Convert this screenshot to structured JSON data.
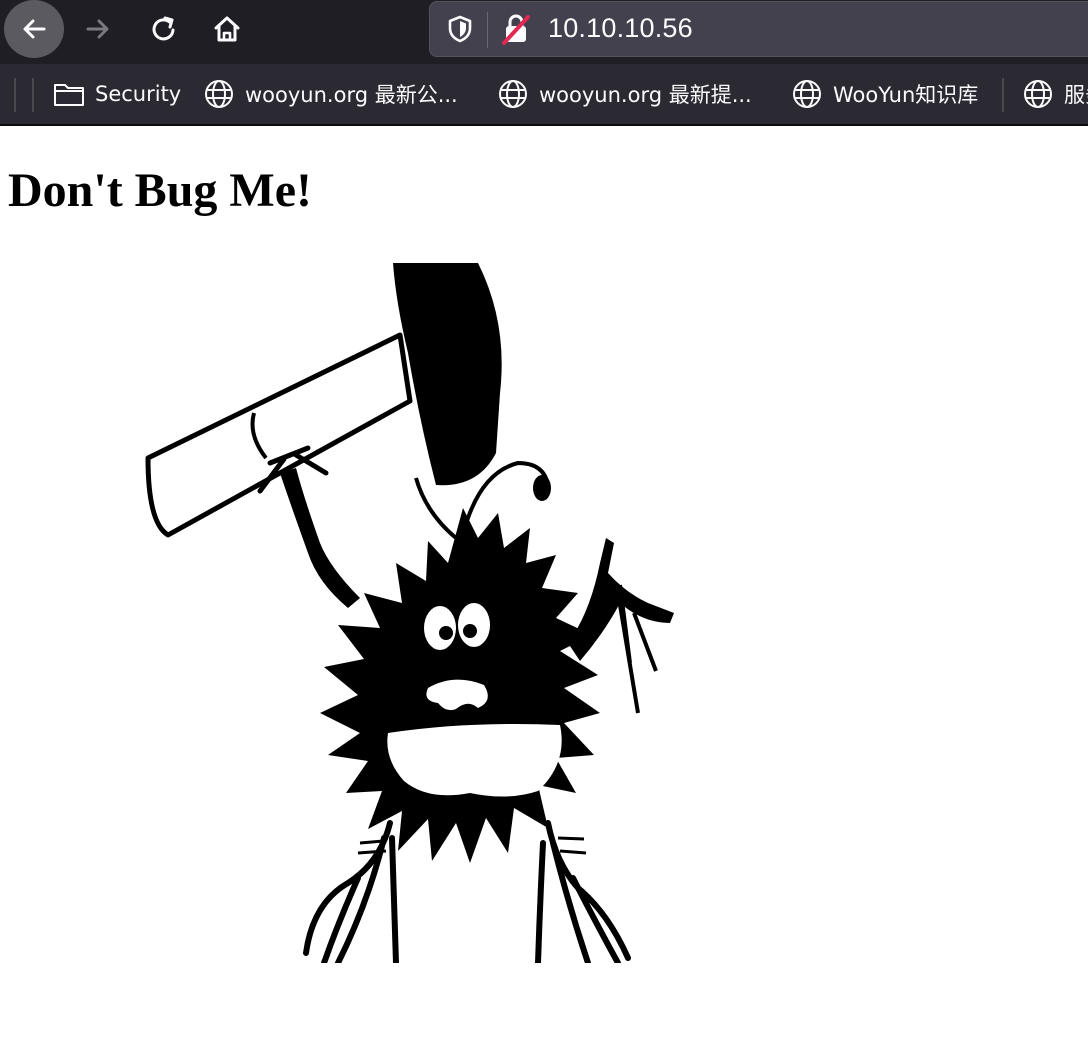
{
  "browser": {
    "url": "10.10.10.56",
    "bookmarks": [
      {
        "label": "Security",
        "icon": "folder-icon"
      },
      {
        "label": "wooyun.org 最新公...",
        "icon": "globe-icon"
      },
      {
        "label": "wooyun.org 最新提...",
        "icon": "globe-icon"
      },
      {
        "label": "WooYun知识库",
        "icon": "globe-icon"
      },
      {
        "label": "服务",
        "icon": "globe-icon"
      }
    ],
    "icons": {
      "back": "back-arrow-icon",
      "forward": "forward-arrow-icon",
      "reload": "reload-icon",
      "home": "home-icon",
      "tracking": "shield-icon",
      "insecure": "insecure-lock-icon"
    },
    "colors": {
      "toolbar": "#1f1e25",
      "bookmarks_bar": "#2b2a33",
      "urlbar": "#42414d",
      "insecure_slash": "#e22850"
    }
  },
  "page": {
    "title": "Don't Bug Me!",
    "image": {
      "subject": "bug-with-hammer-image"
    }
  }
}
